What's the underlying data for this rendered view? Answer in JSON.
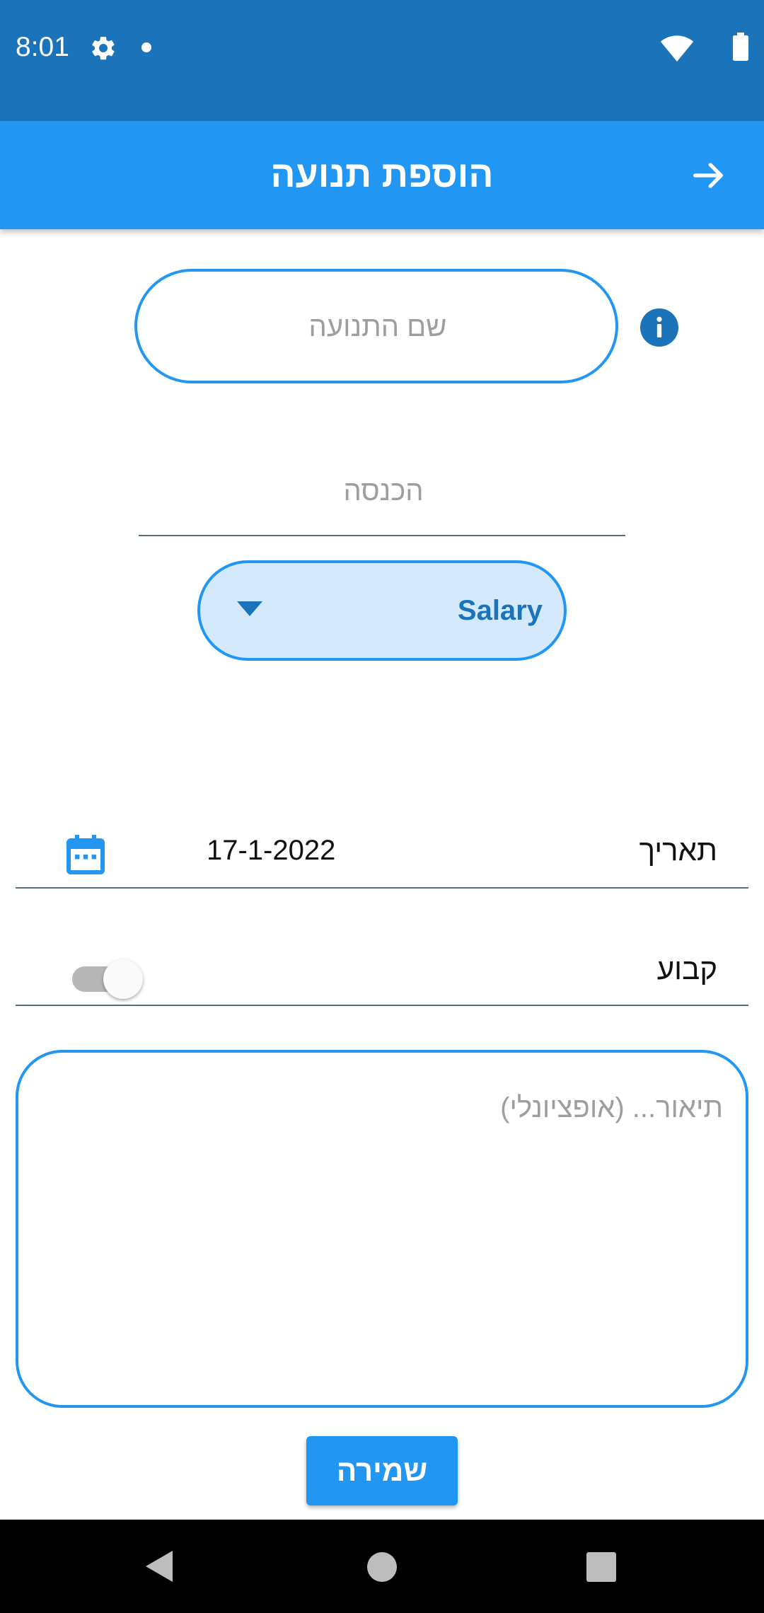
{
  "status_bar": {
    "time": "8:01",
    "icons": [
      "gear-icon",
      "notification-dot-icon",
      "wifi-icon",
      "battery-icon"
    ]
  },
  "app_bar": {
    "title": "הוספת תנועה",
    "back_icon": "arrow-right-icon",
    "color": "#2196f3"
  },
  "form": {
    "name_placeholder": "שם התנועה",
    "info_icon": "info-icon",
    "amount_placeholder": "הכנסה",
    "category": {
      "selected": "Salary",
      "icon": "chevron-down-icon"
    },
    "date": {
      "label": "תאריך",
      "value": "17-1-2022",
      "icon": "calendar-icon"
    },
    "fixed": {
      "label": "קבוע",
      "enabled": false
    },
    "description_placeholder": "תיאור... (אופציונלי)",
    "save_label": "שמירה"
  },
  "nav_bar": {
    "icons": [
      "back-triangle-icon",
      "home-circle-icon",
      "recents-square-icon"
    ]
  },
  "colors": {
    "status_bar": "#1b73b9",
    "accent": "#2196f3",
    "dropdown_fill": "#d4e9fb"
  }
}
